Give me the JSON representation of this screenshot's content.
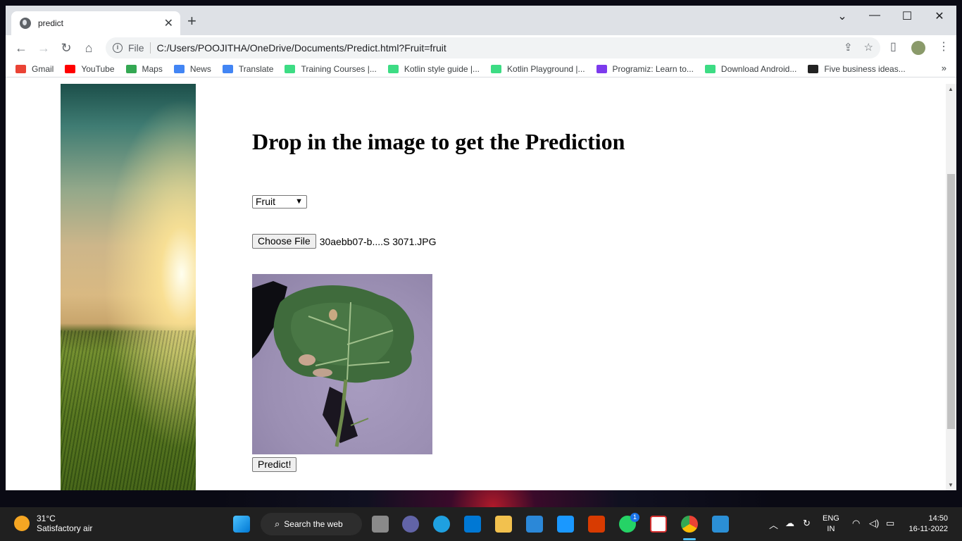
{
  "browser": {
    "tab_title": "predict",
    "url_scheme": "File",
    "url": "C:/Users/POOJITHA/OneDrive/Documents/Predict.html?Fruit=fruit",
    "bookmarks": [
      {
        "label": "Gmail",
        "color": "#ea4335"
      },
      {
        "label": "YouTube",
        "color": "#ff0000"
      },
      {
        "label": "Maps",
        "color": "#34a853"
      },
      {
        "label": "News",
        "color": "#4285f4"
      },
      {
        "label": "Translate",
        "color": "#4285f4"
      },
      {
        "label": "Training Courses |...",
        "color": "#3ddc84"
      },
      {
        "label": "Kotlin style guide |...",
        "color": "#3ddc84"
      },
      {
        "label": "Kotlin Playground |...",
        "color": "#3ddc84"
      },
      {
        "label": "Programiz: Learn to...",
        "color": "#7c3aed"
      },
      {
        "label": "Download Android...",
        "color": "#3ddc84"
      },
      {
        "label": "Five business ideas...",
        "color": "#222222"
      }
    ]
  },
  "page": {
    "heading": "Drop in the image to get the Prediction",
    "select_value": "Fruit",
    "choose_file_label": "Choose File",
    "file_name": "30aebb07-b....S 3071.JPG",
    "predict_label": "Predict!"
  },
  "taskbar": {
    "temperature": "31°C",
    "weather_desc": "Satisfactory air",
    "search_label": "Search the web",
    "lang_top": "ENG",
    "lang_bottom": "IN",
    "time": "14:50",
    "date": "16-11-2022",
    "whatsapp_badge": "1"
  }
}
